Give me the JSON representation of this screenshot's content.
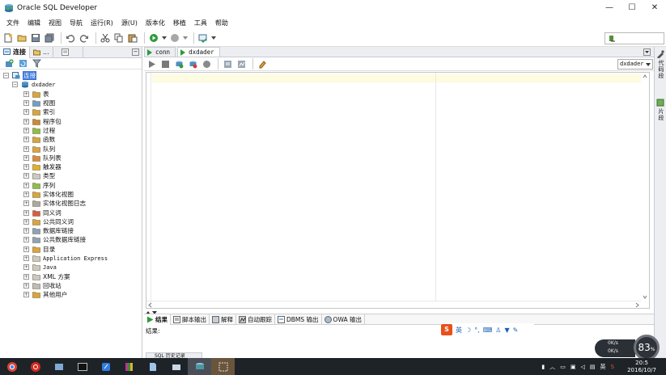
{
  "window": {
    "title": "Oracle SQL Developer",
    "controls": [
      "—",
      "☐",
      "✕"
    ]
  },
  "menu": [
    "文件",
    "编辑",
    "视图",
    "导航",
    "运行(R)",
    "源(U)",
    "版本化",
    "移植",
    "工具",
    "帮助"
  ],
  "left_panel": {
    "tabs": [
      "连接",
      "...",
      ""
    ],
    "tree": {
      "root_label": "连接",
      "connection": "dxdader",
      "nodes": [
        {
          "label": "表",
          "mono": false
        },
        {
          "label": "视图",
          "mono": false
        },
        {
          "label": "索引",
          "mono": false
        },
        {
          "label": "程序包",
          "mono": false
        },
        {
          "label": "过程",
          "mono": false
        },
        {
          "label": "函数",
          "mono": false
        },
        {
          "label": "队列",
          "mono": false
        },
        {
          "label": "队列表",
          "mono": false
        },
        {
          "label": "触发器",
          "mono": false
        },
        {
          "label": "类型",
          "mono": false
        },
        {
          "label": "序列",
          "mono": false
        },
        {
          "label": "实体化视图",
          "mono": false
        },
        {
          "label": "实体化视图日志",
          "mono": false
        },
        {
          "label": "同义词",
          "mono": false
        },
        {
          "label": "公共同义词",
          "mono": false
        },
        {
          "label": "数据库链接",
          "mono": false
        },
        {
          "label": "公共数据库链接",
          "mono": false
        },
        {
          "label": "目录",
          "mono": false
        },
        {
          "label": "Application Express",
          "mono": true
        },
        {
          "label": "Java",
          "mono": true
        },
        {
          "label": "XML 方案",
          "mono": false
        },
        {
          "label": "回收站",
          "mono": false
        },
        {
          "label": "其他用户",
          "mono": false
        }
      ]
    }
  },
  "editor": {
    "tabs": [
      {
        "label": "conn",
        "active": false
      },
      {
        "label": "dxdader",
        "active": true
      }
    ],
    "connection_select": "dxdader"
  },
  "results": {
    "tabs": [
      "结果",
      "脚本输出",
      "解释",
      "自动跟踪",
      "DBMS 输出",
      "OWA 输出"
    ],
    "label": "结果:",
    "history_tab": "SQL 历史记录"
  },
  "right_strip": {
    "items": [
      "代码段",
      "片段"
    ]
  },
  "ime": {
    "logo": "S",
    "mode": "英"
  },
  "taskbar": {
    "clock_time": "20:5",
    "clock_date": "2016/10/7",
    "net_up": "0K/s",
    "net_down": "0K/s",
    "net_percent": "83",
    "net_percent_unit": "%"
  },
  "colors": {
    "accent_green": "#2e9a3a",
    "selection": "#3875d7",
    "taskbar": "#1e2328"
  }
}
